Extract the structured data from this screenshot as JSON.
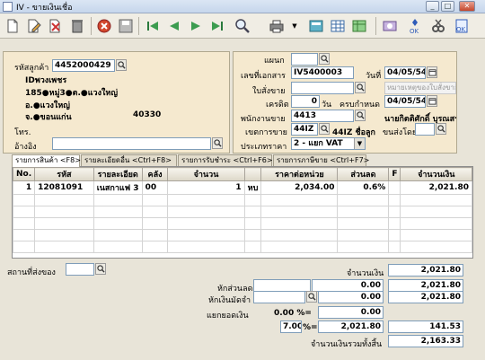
{
  "window": {
    "title": "IV - ขายเงินเชื่อ",
    "minimize": "_",
    "maximize": "□",
    "close": "✕"
  },
  "toolbar": {
    "icons": [
      "new-icon",
      "edit-icon",
      "delete-draft-icon",
      "trash-icon",
      "cancel-icon",
      "save-icon",
      "first-icon",
      "prev-icon",
      "next-icon",
      "last-icon",
      "search-icon",
      "print-icon",
      "calculator-icon",
      "grid-icon",
      "spreadsheet-icon",
      "money-icon",
      "doc-icon",
      "approve-icon",
      "tools-icon",
      "exit-icon"
    ]
  },
  "customer": {
    "code_label": "รหัสลูกค้า",
    "code": "4452000429",
    "name": "IDพวงเพชร",
    "address1": "185●หมู่3●ต.●แวงใหญ่",
    "address2": "อ.●แวงใหญ่",
    "address3": "จ.●ขอนแก่น",
    "postcode": "40330",
    "phone_label": "โทร.",
    "ref_label": "อ้างอิง",
    "ref_value": ""
  },
  "document": {
    "dept_label": "แผนก",
    "dept": "",
    "docno_label": "เลขที่เอกสาร",
    "docno": "IV5400003",
    "date_label": "วันที่",
    "date": "04/05/54",
    "order_label": "ใบสั่งขาย",
    "order": "",
    "order_note": "หมายเหตุของใบสั่งขาย",
    "credit_label": "เครดิต",
    "credit": "0",
    "credit_unit": "วัน",
    "due_label": "ครบกำหนด",
    "due": "04/05/54",
    "salesman_label": "พนักงานขาย",
    "salesman": "4413",
    "salesman_name": "นายกิตติศักดิ์ บุรณสรร",
    "area_label": "เขตการขาย",
    "area": "44IZ",
    "area_name": "44IZ ชื่อลูก",
    "shipby_label": "ขนส่งโดย",
    "pricetype_label": "ประเภทราคา",
    "pricetype": "2 - แยก VAT"
  },
  "tabs": [
    "รายการสินค้า <F8>",
    "รายละเอียดอื่น <Ctrl+F8>",
    "รายการรับชำระ <Ctrl+F6>",
    "รายการภาษีขาย <Ctrl+F7>"
  ],
  "grid": {
    "columns": [
      "No.",
      "รหัส",
      "รายละเอียด",
      "คลัง",
      "จำนวน",
      "",
      "ราคาต่อหน่วย",
      "ส่วนลด",
      "F",
      "จำนวนเงิน"
    ],
    "rows": [
      [
        "1",
        "12081091",
        "เนสกาแฟ 3",
        "00",
        "1",
        "หบ",
        "2,034.00",
        "0.6%",
        "",
        "2,021.80"
      ]
    ]
  },
  "footer": {
    "location_label": "สถานที่ส่งของ",
    "amount_label": "จำนวนเงิน",
    "amount": "2,021.80",
    "discount_label": "หักส่วนลด",
    "discount_pct": "",
    "discount_amt": "0.00",
    "after_discount": "2,021.80",
    "deposit_label": "หักเงินมัดจำ",
    "deposit": "0.00",
    "after_deposit": "2,021.80",
    "separate_label": "แยกยอดเงิน",
    "separate_pct": "0.00 %=",
    "separate_amt": "0.00",
    "vat_rate": "7.00",
    "vat_sign": "%=",
    "vat_base": "2,021.80",
    "vat_amt": "141.53",
    "total_label": "จำนวนเงินรวมทั้งสิ้น",
    "total": "2,163.33"
  }
}
